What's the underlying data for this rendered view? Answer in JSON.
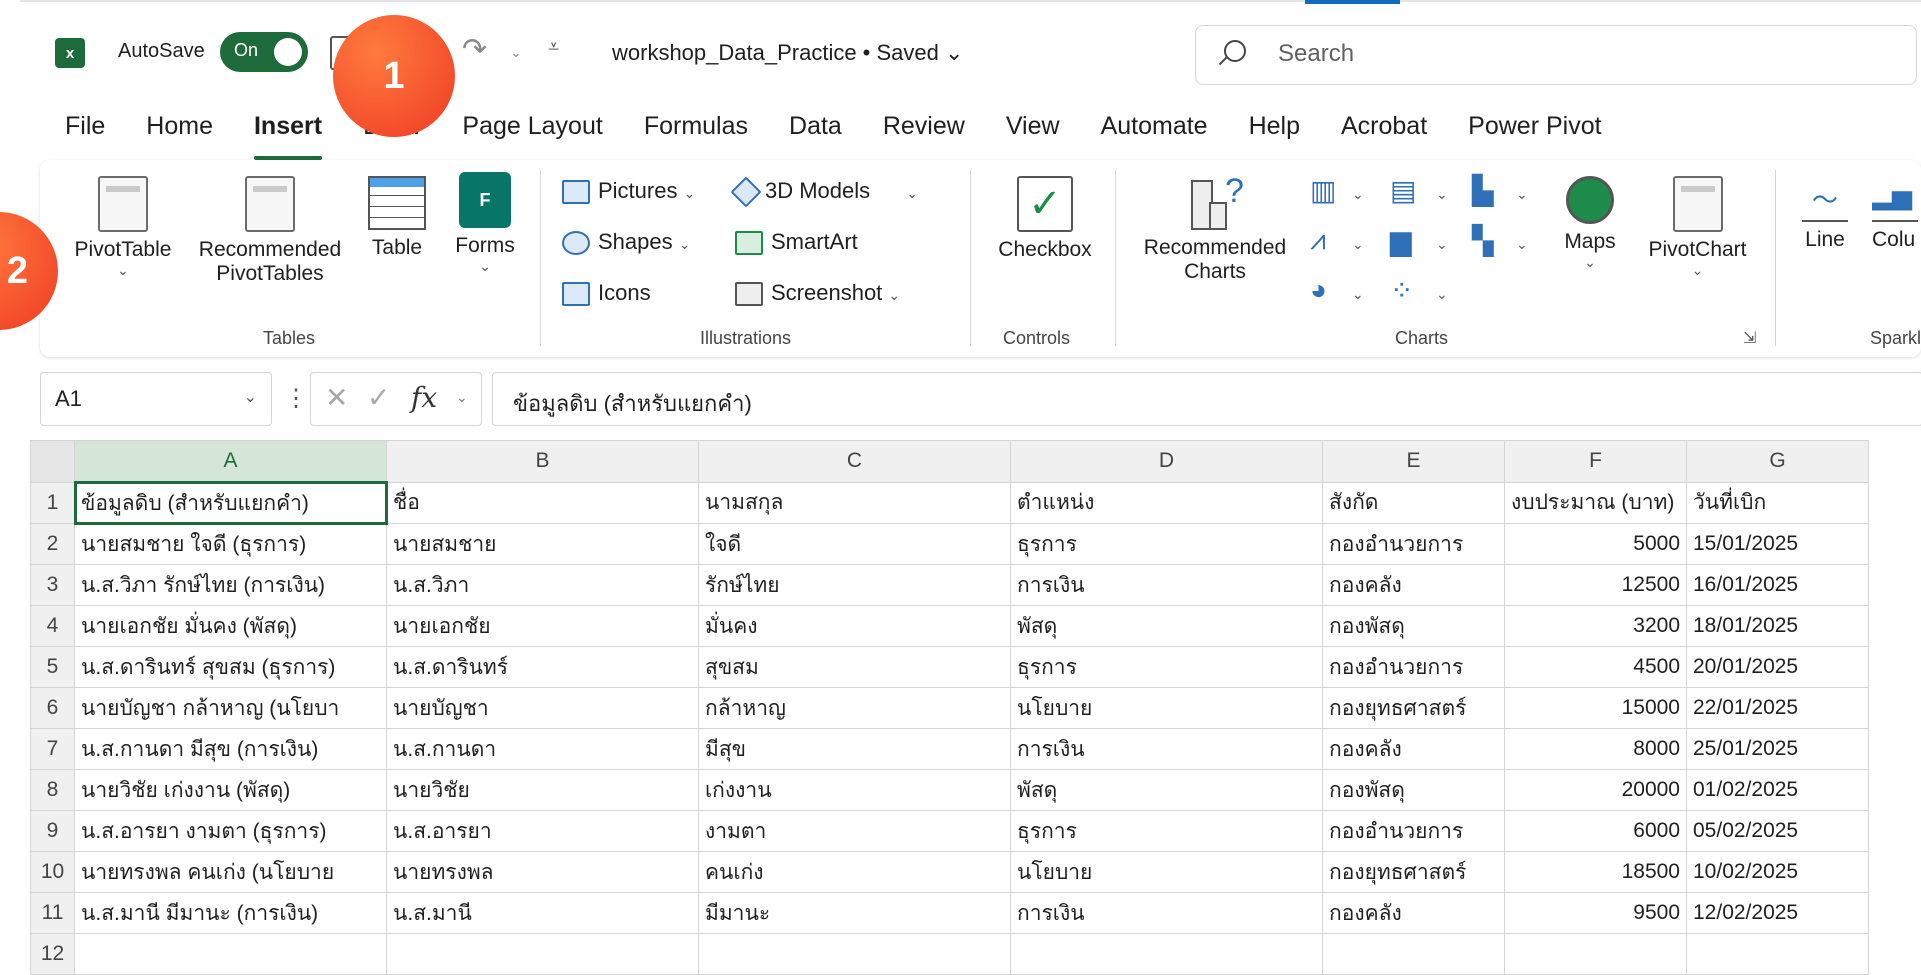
{
  "titlebar": {
    "autosave_label": "AutoSave",
    "toggle_label": "On",
    "file_title": "workshop_Data_Practice • Saved ⌄",
    "search_placeholder": "Search"
  },
  "tabs": [
    "File",
    "Home",
    "Insert",
    "Draw",
    "Page Layout",
    "Formulas",
    "Data",
    "Review",
    "View",
    "Automate",
    "Help",
    "Acrobat",
    "Power Pivot"
  ],
  "active_tab": "Insert",
  "ribbon": {
    "tables": {
      "pivottable": "PivotTable",
      "recommended_line1": "Recommended",
      "recommended_line2": "PivotTables",
      "table": "Table",
      "forms": "Forms",
      "group_label": "Tables"
    },
    "illustrations": {
      "pictures": "Pictures",
      "shapes": "Shapes",
      "icons": "Icons",
      "models3d": "3D Models",
      "smartart": "SmartArt",
      "screenshot": "Screenshot",
      "group_label": "Illustrations"
    },
    "controls": {
      "checkbox": "Checkbox",
      "group_label": "Controls"
    },
    "charts": {
      "recommended_line1": "Recommended",
      "recommended_line2": "Charts",
      "maps": "Maps",
      "pivotchart": "PivotChart",
      "group_label": "Charts"
    },
    "sparklines": {
      "line": "Line",
      "column": "Colu",
      "group_label": "Sparkl"
    }
  },
  "formula_bar": {
    "name_box": "A1",
    "fx_label": "fx",
    "formula": "ข้อมูลดิบ (สำหรับแยกคำ)"
  },
  "sheet": {
    "columns": [
      "A",
      "B",
      "C",
      "D",
      "E",
      "F",
      "G"
    ],
    "rows": [
      [
        "ข้อมูลดิบ (สำหรับแยกคำ)",
        "ชื่อ",
        "นามสกุล",
        "ตำแหน่ง",
        "สังกัด",
        "งบประมาณ (บาท)",
        "วันที่เบิก"
      ],
      [
        "นายสมชาย ใจดี (ธุรการ)",
        "นายสมชาย",
        "ใจดี",
        "ธุรการ",
        "กองอำนวยการ",
        "5000",
        "15/01/2025"
      ],
      [
        "น.ส.วิภา รักษ์ไทย (การเงิน)",
        "น.ส.วิภา",
        "รักษ์ไทย",
        "การเงิน",
        "กองคลัง",
        "12500",
        "16/01/2025"
      ],
      [
        "นายเอกชัย มั่นคง (พัสดุ)",
        "นายเอกชัย",
        "มั่นคง",
        "พัสดุ",
        "กองพัสดุ",
        "3200",
        "18/01/2025"
      ],
      [
        "น.ส.ดารินทร์ สุขสม (ธุรการ)",
        "น.ส.ดารินทร์",
        "สุขสม",
        "ธุรการ",
        "กองอำนวยการ",
        "4500",
        "20/01/2025"
      ],
      [
        "นายบัญชา กล้าหาญ (นโยบา",
        "นายบัญชา",
        "กล้าหาญ",
        "นโยบาย",
        "กองยุทธศาสตร์",
        "15000",
        "22/01/2025"
      ],
      [
        "น.ส.กานดา มีสุข (การเงิน)",
        "น.ส.กานดา",
        "มีสุข",
        "การเงิน",
        "กองคลัง",
        "8000",
        "25/01/2025"
      ],
      [
        "นายวิชัย เก่งงาน (พัสดุ)",
        "นายวิชัย",
        "เก่งงาน",
        "พัสดุ",
        "กองพัสดุ",
        "20000",
        "01/02/2025"
      ],
      [
        "น.ส.อารยา งามตา (ธุรการ)",
        "น.ส.อารยา",
        "งามตา",
        "ธุรการ",
        "กองอำนวยการ",
        "6000",
        "05/02/2025"
      ],
      [
        "นายทรงพล คนเก่ง (นโยบาย",
        "นายทรงพล",
        "คนเก่ง",
        "นโยบาย",
        "กองยุทธศาสตร์",
        "18500",
        "10/02/2025"
      ],
      [
        "น.ส.มานี มีมานะ (การเงิน)",
        "น.ส.มานี",
        "มีมานะ",
        "การเงิน",
        "กองคลัง",
        "9500",
        "12/02/2025"
      ],
      [
        "",
        "",
        "",
        "",
        "",
        "",
        ""
      ]
    ]
  },
  "overlays": {
    "badge1": "1",
    "badge2": "2"
  },
  "colors": {
    "excel_green": "#1d6b3a",
    "badge_orange": "#ef3b24"
  }
}
